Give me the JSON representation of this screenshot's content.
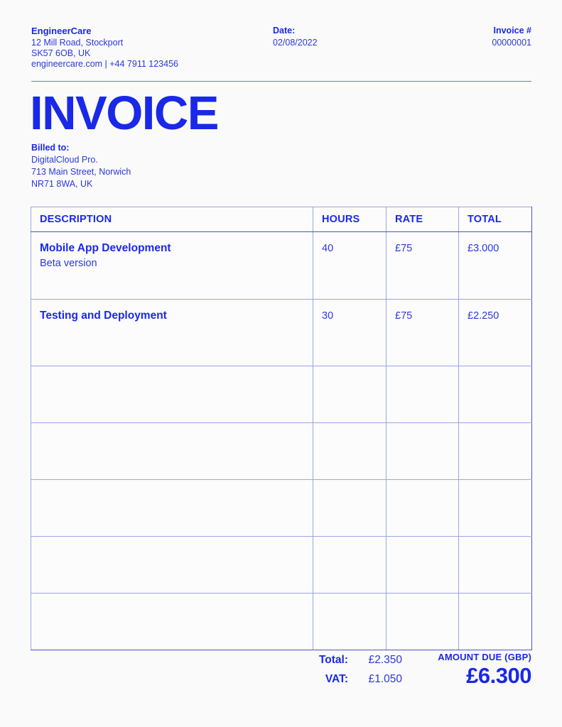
{
  "header": {
    "company": {
      "name": "EngineerCare",
      "address_line1": "12 Mill Road, Stockport",
      "address_line2": "SK57 6OB, UK",
      "contact": "engineercare.com | +44 7911 123456"
    },
    "date": {
      "label": "Date:",
      "value": "02/08/2022"
    },
    "invoice_number": {
      "label": "Invoice #",
      "value": "00000001"
    }
  },
  "title": "INVOICE",
  "billed_to": {
    "label": "Billed to:",
    "name": "DigitalCloud Pro.",
    "address_line1": "713 Main Street, Norwich",
    "address_line2": "NR71 8WA, UK"
  },
  "table": {
    "columns": [
      "DESCRIPTION",
      "HOURS",
      "RATE",
      "TOTAL"
    ],
    "rows": [
      {
        "description": "Mobile App Development",
        "sub_description": "Beta version",
        "hours": "40",
        "rate": "£75",
        "total": "£3.000"
      },
      {
        "description": "Testing and Deployment",
        "sub_description": "",
        "hours": "30",
        "rate": "£75",
        "total": "£2.250"
      }
    ],
    "empty_row_count": 5
  },
  "totals": {
    "total_label": "Total:",
    "total_value": "£2.350",
    "vat_label": "VAT:",
    "vat_value": "£1.050",
    "amount_due_label": "AMOUNT DUE (GBP)",
    "amount_due_value": "£6.300"
  },
  "colors": {
    "brand_blue": "#1a28e8",
    "text_blue": "#2b38dd",
    "grid_line": "#9aa6e4",
    "frame_line": "#4a56c4",
    "page_background": "#fafafa"
  }
}
